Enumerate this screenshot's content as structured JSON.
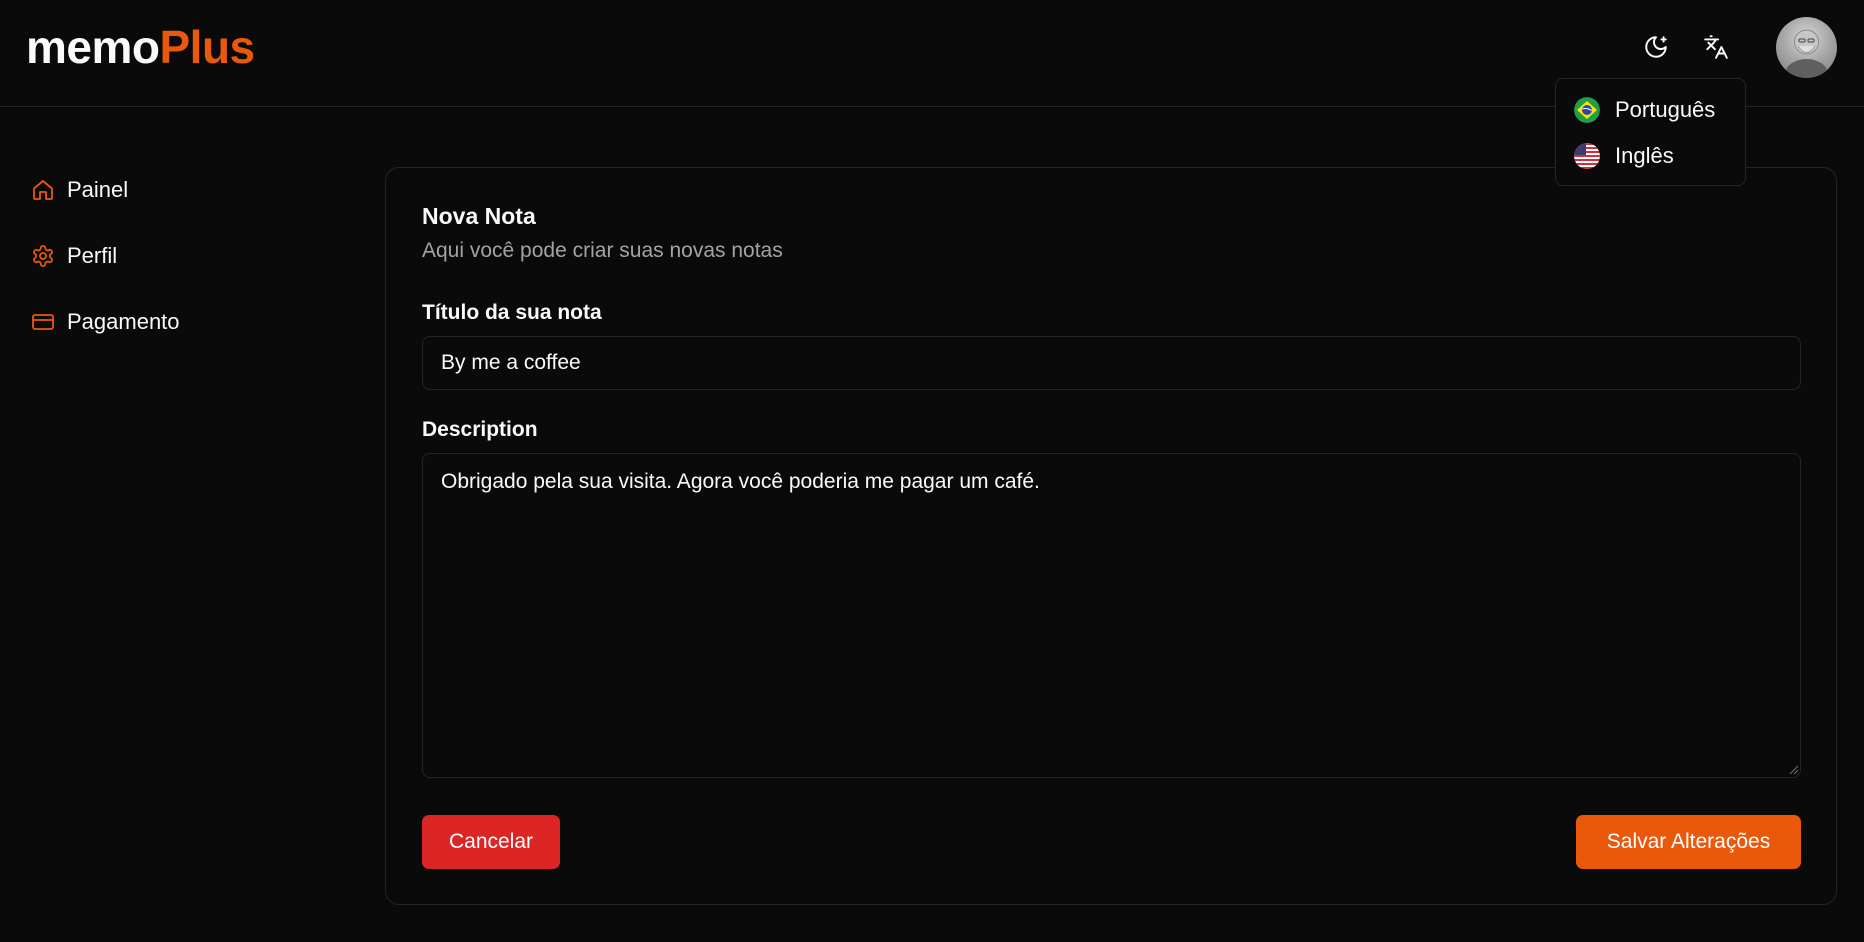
{
  "header": {
    "logo_part1": "memo",
    "logo_part2": "Plus",
    "icons": [
      "theme-toggle-icon",
      "translate-icon"
    ],
    "avatar": "user-avatar"
  },
  "language_menu": {
    "items": [
      {
        "label": "Português",
        "flag": "brazil-flag-icon"
      },
      {
        "label": "Inglês",
        "flag": "usa-flag-icon"
      }
    ]
  },
  "sidebar": {
    "items": [
      {
        "label": "Painel",
        "icon": "home-icon"
      },
      {
        "label": "Perfil",
        "icon": "gear-icon"
      },
      {
        "label": "Pagamento",
        "icon": "credit-card-icon"
      }
    ]
  },
  "form": {
    "title": "Nova Nota",
    "subtitle": "Aqui você pode criar suas novas notas",
    "title_label": "Título da sua nota",
    "title_value": "By me a coffee",
    "description_label": "Description",
    "description_value": "Obrigado pela sua visita. Agora você poderia me pagar um café.",
    "cancel_label": "Cancelar",
    "save_label": "Salvar Alterações"
  },
  "colors": {
    "accent": "#ea580c",
    "danger": "#dc2626",
    "background": "#0a0a0a",
    "border": "#262626",
    "muted_text": "#a3a3a3"
  }
}
